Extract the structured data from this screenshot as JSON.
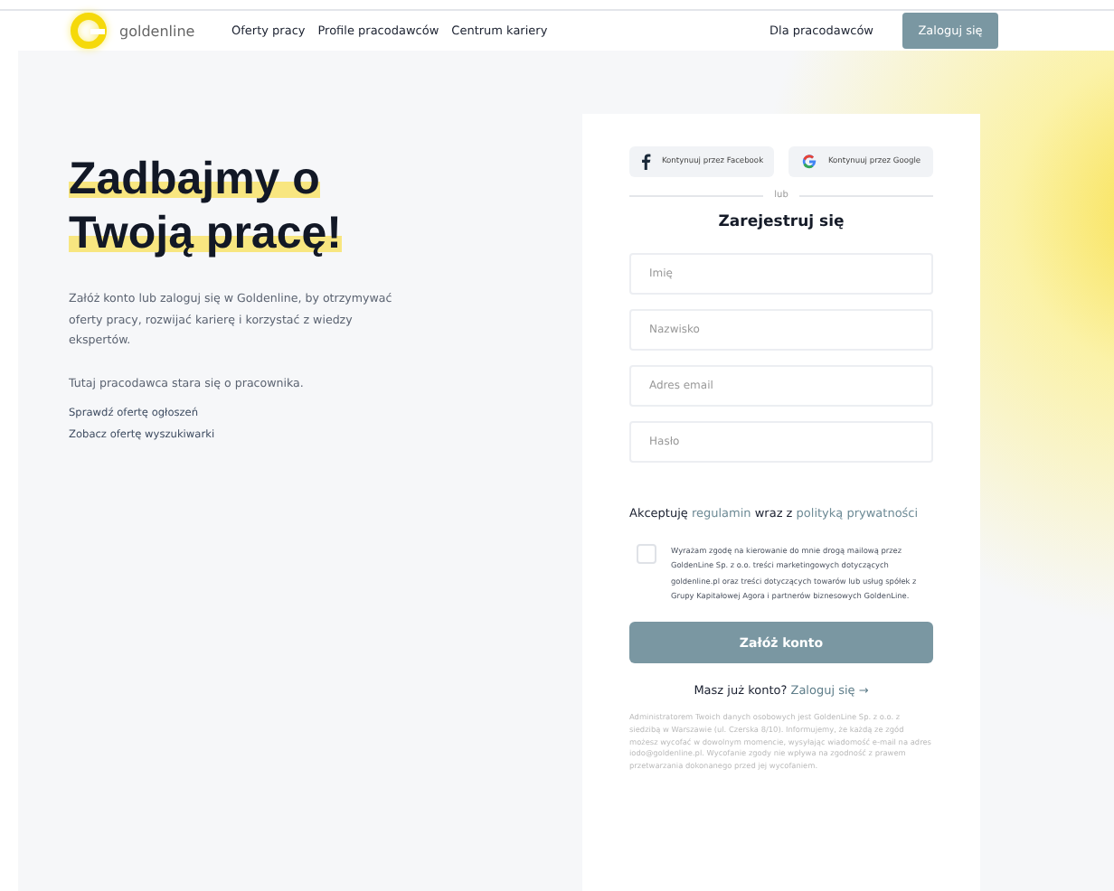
{
  "header": {
    "logo": "goldenline",
    "nav": [
      "Oferty pracy",
      "Profile pracodawców",
      "Centrum kariery"
    ],
    "employers_link": "Dla pracodawców",
    "login_button": "Zaloguj się"
  },
  "hero": {
    "title_lines": [
      "Zadbajmy o",
      "Twoją pracę!"
    ],
    "description": "Załóż konto lub zaloguj się w Goldenline, by otrzymywać oferty pracy, rozwijać karierę i korzystać z wiedzy ekspertów.",
    "employer_note": "Tutaj pracodawca stara się o pracownika.",
    "links": [
      "Sprawdź ofertę ogłoszeń",
      "Zobacz ofertę wyszukiwarki"
    ]
  },
  "form": {
    "social_buttons": [
      {
        "kind": "facebook",
        "label": "Kontynuuj przez Facebook"
      },
      {
        "kind": "google",
        "label": "Kontynuuj przez Google"
      }
    ],
    "divider": "lub",
    "title": "Zarejestruj się",
    "fields": [
      {
        "placeholder": "Imię"
      },
      {
        "placeholder": "Nazwisko"
      },
      {
        "placeholder": "Adres email"
      },
      {
        "placeholder": "Hasło"
      }
    ],
    "terms": {
      "before": "Akceptuję",
      "link1": "regulamin",
      "middle": "wraz z",
      "link2": "polityką prywatności"
    },
    "consent": {
      "checked": false,
      "text": "Wyrażam zgodę na kierowanie do mnie drogą mailową przez GoldenLine Sp. z o.o. treści marketingowych dotyczących goldenline.pl oraz treści dotyczących towarów lub usług spółek z Grupy Kapitałowej Agora i partnerów biznesowych GoldenLine."
    },
    "submit": "Załóż konto",
    "have_account": "Masz już konto?",
    "login_link": "Zaloguj się →",
    "legal": "Administratorem Twoich danych osobowych jest GoldenLine Sp. z o.o. z siedzibą w Warszawie (ul. Czerska 8/10). Informujemy, że każdą ze zgód możesz wycofać w dowolnym momencie, wysyłając wiadomość e-mail na adres iodo@goldenline.pl. Wycofanie zgody nie wpływa na zgodność z prawem przetwarzania dokonanego przed jej wycofaniem."
  }
}
